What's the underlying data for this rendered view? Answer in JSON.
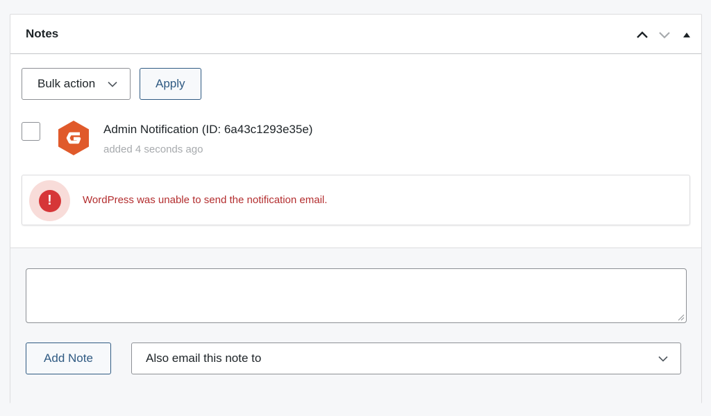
{
  "panel": {
    "title": "Notes",
    "controls": {
      "move_up_icon": "chevron-up-icon",
      "move_down_icon": "chevron-down-icon",
      "toggle_icon": "triangle-up-icon"
    }
  },
  "toolbar": {
    "bulk_action_label": "Bulk action",
    "apply_label": "Apply"
  },
  "note": {
    "title": "Admin Notification (ID: 6a43c1293e35e)",
    "time": "added 4 seconds ago",
    "logo_color": "#e05a2b"
  },
  "alert": {
    "icon_glyph": "!",
    "message": "WordPress was unable to send the notification email.",
    "color": "#d63638"
  },
  "add_note": {
    "textarea_value": "",
    "button_label": "Add Note",
    "email_select_label": "Also email this note to"
  },
  "colors": {
    "accent": "#2f5a82",
    "error": "#d63638",
    "error_text": "#b32d2e",
    "muted_text": "#a7aaad"
  }
}
